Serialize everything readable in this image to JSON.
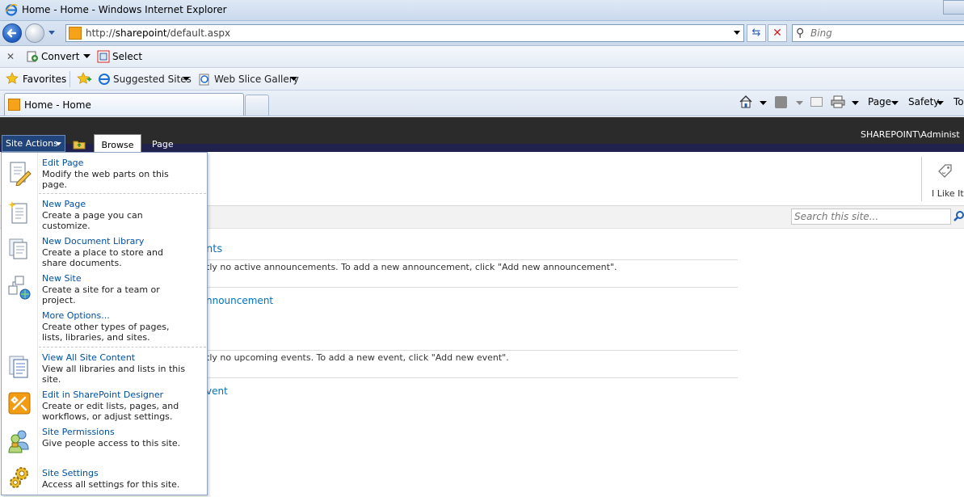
{
  "browser": {
    "window_title": "Home - Home - Windows Internet Explorer",
    "address_url_prefix": "http://",
    "address_url_host": "sharepoint",
    "address_url_path": "/default.aspx",
    "search_placeholder": "Bing",
    "toolbar": {
      "convert_label": "Convert",
      "select_label": "Select"
    },
    "favorites_bar": {
      "favorites_label": "Favorites",
      "suggested_sites_label": "Suggested Sites",
      "web_slice_gallery_label": "Web Slice Gallery"
    },
    "tab_title": "Home - Home",
    "command_bar": {
      "page_label": "Page",
      "safety_label": "Safety",
      "tools_label": "To"
    }
  },
  "sharepoint": {
    "site_actions_label": "Site Actions",
    "tabs": [
      {
        "label": "Browse"
      },
      {
        "label": "Page"
      }
    ],
    "user_label": "SHAREPOINT\\Administ",
    "i_like_it_label": "I Like It",
    "search_placeholder": "Search this site...",
    "content": {
      "announcements_title_fragment": "nts",
      "announcements_empty_msg": "tly no active announcements. To add a new announcement, click \"Add new announcement\".",
      "add_announcement_link": "nnouncement",
      "events_empty_msg": "tly no upcoming events. To add a new event, click \"Add new event\".",
      "add_event_link": "vent"
    },
    "site_actions_menu": {
      "items": [
        {
          "title": "Edit Page",
          "description": "Modify the web parts on this page.",
          "icon": "edit-page-icon"
        },
        {
          "title": "New Page",
          "description": "Create a page you can customize.",
          "icon": "new-page-icon"
        },
        {
          "title": "New Document Library",
          "description": "Create a place to store and share documents.",
          "icon": "document-library-icon"
        },
        {
          "title": "New Site",
          "description": "Create a site for a team or project.",
          "icon": "new-site-icon"
        },
        {
          "title": "More Options...",
          "description": "Create other types of pages, lists, libraries, and sites.",
          "icon": ""
        },
        {
          "title": "View All Site Content",
          "description": "View all libraries and lists in this site.",
          "icon": "site-content-icon"
        },
        {
          "title": "Edit in SharePoint Designer",
          "description": "Create or edit lists, pages, and workflows, or adjust settings.",
          "icon": "sharepoint-designer-icon"
        },
        {
          "title": "Site Permissions",
          "description": "Give people access to this site.",
          "icon": "permissions-icon"
        },
        {
          "title": "Site Settings",
          "description": "Access all settings for this site.",
          "icon": "settings-gear-icon"
        }
      ]
    }
  },
  "colors": {
    "link_blue": "#0072bc",
    "menu_title_blue": "#0050a0",
    "sp_topbar": "#2b2b2b",
    "site_actions_bg": "#21447a"
  }
}
